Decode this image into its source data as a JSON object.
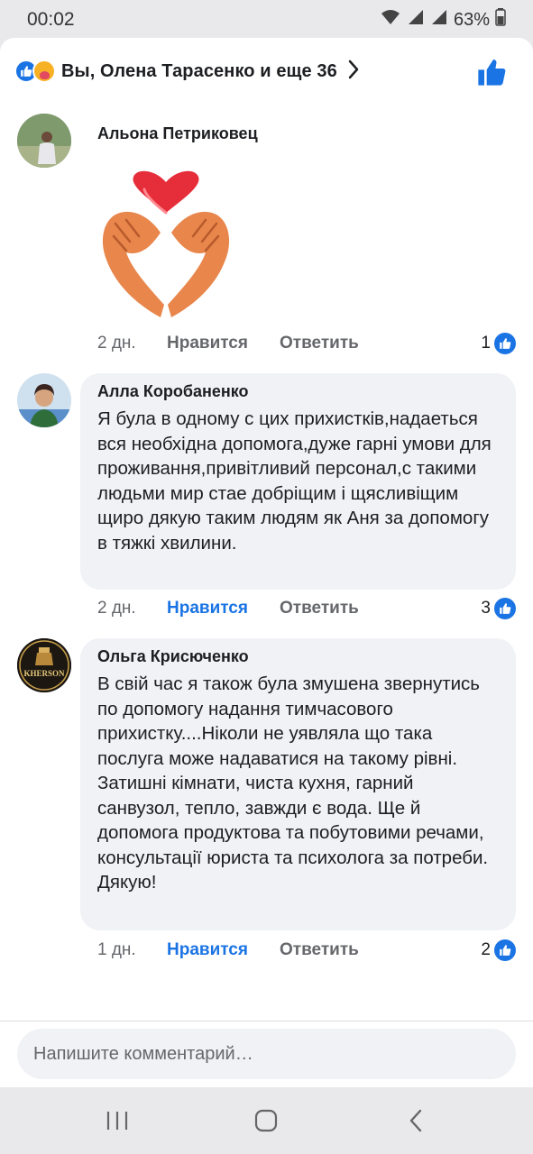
{
  "status_bar": {
    "time": "00:02",
    "battery": "63%"
  },
  "reactions": {
    "summary": "Вы, Олена Тарасенко и еще 36"
  },
  "comments": [
    {
      "author": "Альона Петриковец",
      "time": "2 дн.",
      "like_label": "Нравится",
      "reply_label": "Ответить",
      "likes": "1",
      "liked": false
    },
    {
      "author": "Алла Коробаненко",
      "text": "Я була в одному с цих прихистків,надаеться вся необхідна допомога,дуже гарні умови для проживання,привітливий персонал,с такими людьми мир стае добріщим і щясливіщим щиро дякую таким людям як Аня за допомогу в тяжкі хвилини.",
      "time": "2 дн.",
      "like_label": "Нравится",
      "reply_label": "Ответить",
      "likes": "3",
      "liked": true
    },
    {
      "author": "Ольга Крисюченко",
      "avatar_text": "KHERSON",
      "text": "В свій час я також була змушена звернутись по допомогу надання тимчасового прихистку....Ніколи не уявляла що така послуга може надаватися на такому рівні. Затишні кімнати, чиста кухня, гарний санвузол, тепло, завжди є вода. Ще й допомога продуктова та побутовими речами, консультації юриста та психолога за потреби. Дякую!",
      "time": "1 дн.",
      "like_label": "Нравится",
      "reply_label": "Ответить",
      "likes": "2",
      "liked": true
    }
  ],
  "composer": {
    "placeholder": "Напишите комментарий…"
  },
  "colors": {
    "accent": "#1b74e4",
    "bubble": "#f0f2f5",
    "muted": "#65676b"
  }
}
